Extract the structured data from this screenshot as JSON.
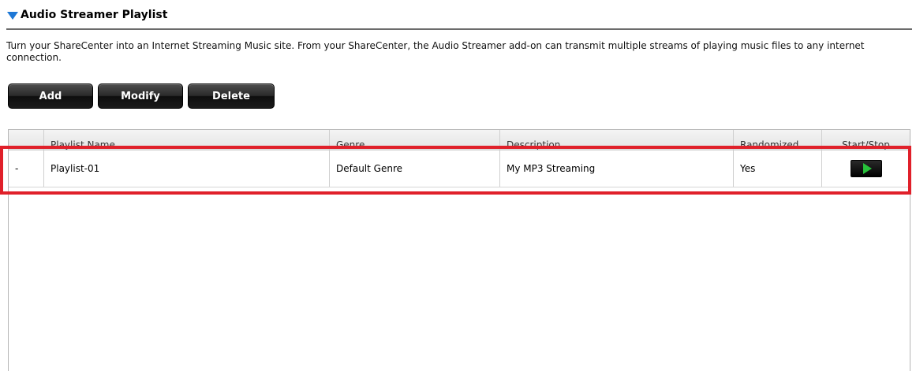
{
  "section": {
    "title": "Audio Streamer Playlist",
    "description": "Turn your ShareCenter into an Internet Streaming Music site. From your ShareCenter, the Audio Streamer add-on can transmit multiple streams of playing music files to any internet connection."
  },
  "toolbar": {
    "add_label": "Add",
    "modify_label": "Modify",
    "delete_label": "Delete"
  },
  "table": {
    "columns": [
      "",
      "Playlist Name",
      "Genre",
      "Description",
      "Randomized",
      "Start/Stop"
    ],
    "rows": [
      {
        "marker": "-",
        "name": "Playlist-01",
        "genre": "Default Genre",
        "description": "My MP3 Streaming",
        "randomized": "Yes",
        "action_icon": "play-icon"
      }
    ]
  },
  "colors": {
    "accent_triangle": "#1e78d6",
    "highlight_border": "#e0202a",
    "play_green": "#27c23a"
  }
}
